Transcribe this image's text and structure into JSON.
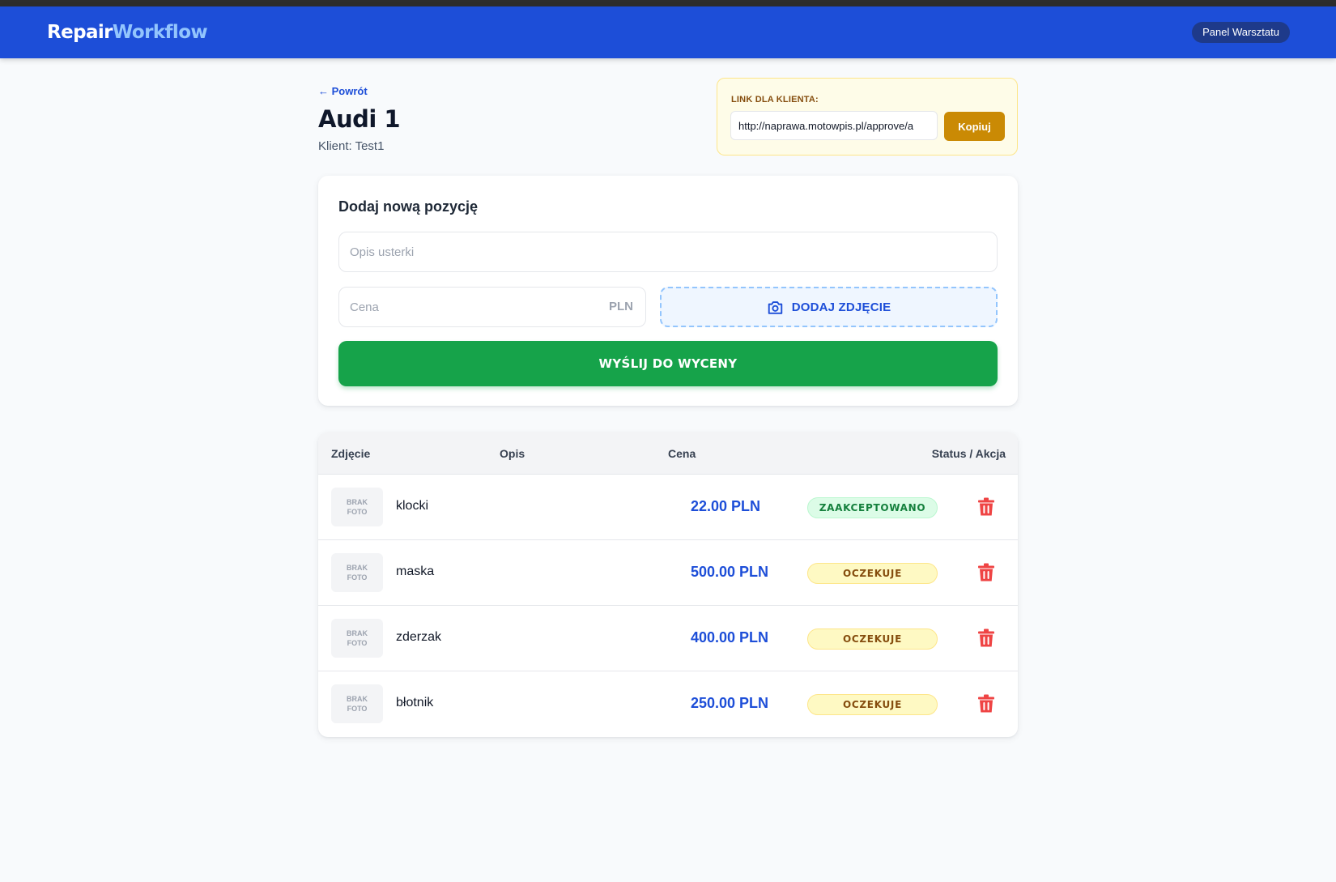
{
  "header": {
    "brand_part1": "Repair",
    "brand_part2": "Workflow",
    "panel_label": "Panel Warsztatu"
  },
  "page": {
    "back_link": "← Powrót",
    "title": "Audi 1",
    "client_line": "Klient: Test1"
  },
  "client_link": {
    "label": "LINK DLA KLIENTA:",
    "url": "http://naprawa.motowpis.pl/approve/a",
    "copy_label": "Kopiuj"
  },
  "form": {
    "title": "Dodaj nową pozycję",
    "desc_placeholder": "Opis usterki",
    "price_placeholder": "Cena",
    "currency": "PLN",
    "photo_label": "DODAJ ZDJĘCIE",
    "submit_label": "WYŚLIJ DO WYCENY"
  },
  "table": {
    "headers": [
      "Zdjęcie",
      "Opis",
      "Cena",
      "Status / Akcja"
    ],
    "no_photo": [
      "BRAK",
      "FOTO"
    ],
    "rows": [
      {
        "description": "klocki",
        "price": "22.00 PLN",
        "status": "ZAAKCEPTOWANO",
        "status_type": "accepted"
      },
      {
        "description": "maska",
        "price": "500.00 PLN",
        "status": "OCZEKUJE",
        "status_type": "pending"
      },
      {
        "description": "zderzak",
        "price": "400.00 PLN",
        "status": "OCZEKUJE",
        "status_type": "pending"
      },
      {
        "description": "błotnik",
        "price": "250.00 PLN",
        "status": "OCZEKUJE",
        "status_type": "pending"
      }
    ]
  },
  "icons": {
    "photo": "camera-icon",
    "delete": "trash-icon"
  },
  "colors": {
    "primary": "#1d4ed8",
    "success": "#16a34a",
    "warning": "#ca8a04",
    "danger": "#ef4444"
  }
}
